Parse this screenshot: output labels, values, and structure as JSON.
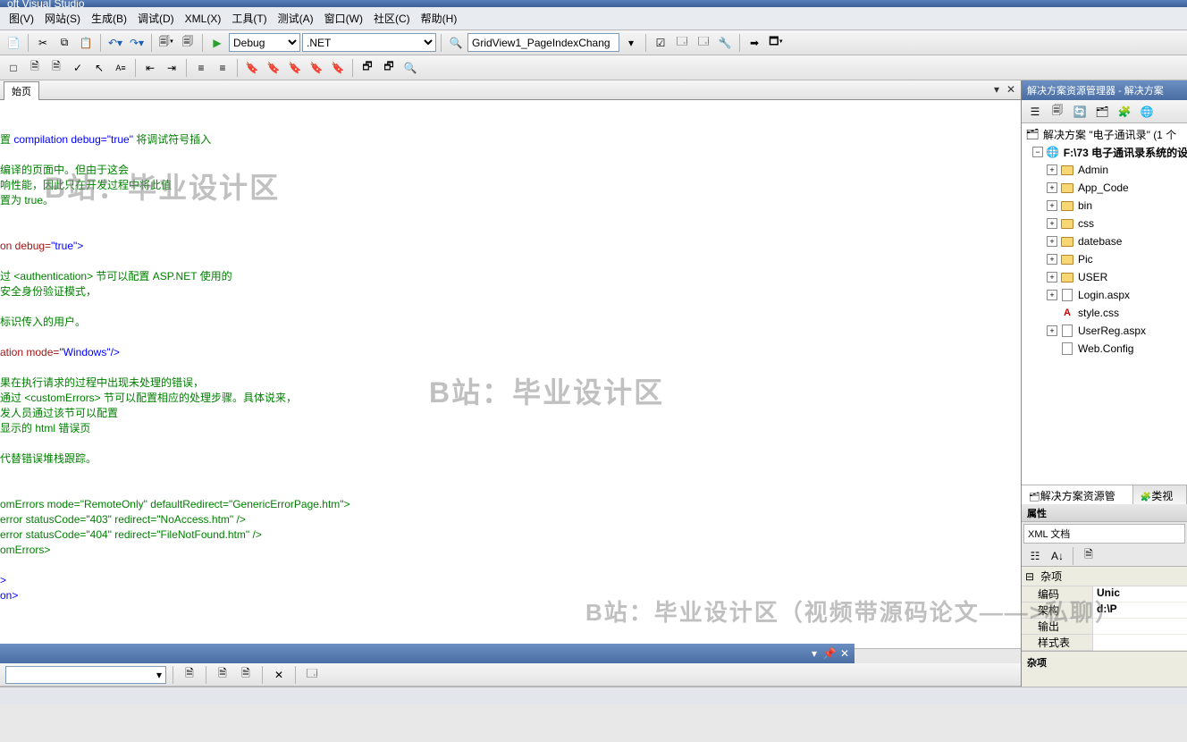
{
  "titlebar": {
    "text": "oft Visual Studio"
  },
  "menu": {
    "view": "图(V)",
    "website": "网站(S)",
    "build": "生成(B)",
    "debug": "调试(D)",
    "xml": "XML(X)",
    "tools": "工具(T)",
    "test": "测试(A)",
    "window": "窗口(W)",
    "community": "社区(C)",
    "help": "帮助(H)"
  },
  "toolbar1": {
    "config": "Debug",
    "platform": ".NET",
    "find": "GridView1_PageIndexChang"
  },
  "doc_tab": {
    "label": "始页"
  },
  "code_lines": [
    {
      "segments": [
        {
          "t": "置 ",
          "c": "green"
        },
        {
          "t": "compilation debug=\"true\"",
          "c": "blue"
        },
        {
          "t": " 将调试符号插入",
          "c": "green"
        }
      ]
    },
    {
      "segments": []
    },
    {
      "segments": [
        {
          "t": "编译的页面中。但由于这会",
          "c": "green"
        }
      ]
    },
    {
      "segments": [
        {
          "t": "响性能，因此只在开发过程中将此值",
          "c": "green"
        }
      ]
    },
    {
      "segments": [
        {
          "t": "置为 true。",
          "c": "green"
        }
      ]
    },
    {
      "segments": []
    },
    {
      "segments": []
    },
    {
      "segments": [
        {
          "t": "on debug=",
          "c": "red"
        },
        {
          "t": "\"true\"",
          "c": "blue"
        },
        {
          "t": ">",
          "c": "blue"
        }
      ]
    },
    {
      "segments": []
    },
    {
      "segments": [
        {
          "t": "过 <authentication> 节可以配置 ASP.NET 使用的",
          "c": "green"
        }
      ]
    },
    {
      "segments": [
        {
          "t": "安全身份验证模式，",
          "c": "green"
        }
      ]
    },
    {
      "segments": []
    },
    {
      "segments": [
        {
          "t": "标识传入的用户。",
          "c": "green"
        }
      ]
    },
    {
      "segments": []
    },
    {
      "segments": [
        {
          "t": "ation mode=",
          "c": "red"
        },
        {
          "t": "\"Windows\"",
          "c": "blue"
        },
        {
          "t": "/>",
          "c": "blue"
        }
      ]
    },
    {
      "segments": []
    },
    {
      "segments": [
        {
          "t": "果在执行请求的过程中出现未处理的错误，",
          "c": "green"
        }
      ]
    },
    {
      "segments": [
        {
          "t": "通过 <customErrors> 节可以配置相应的处理步骤。具体说来，",
          "c": "green"
        }
      ]
    },
    {
      "segments": [
        {
          "t": "发人员通过该节可以配置",
          "c": "green"
        }
      ]
    },
    {
      "segments": [
        {
          "t": "显示的 html 错误页",
          "c": "green"
        }
      ]
    },
    {
      "segments": []
    },
    {
      "segments": [
        {
          "t": "代替错误堆栈跟踪。",
          "c": "green"
        }
      ]
    },
    {
      "segments": []
    },
    {
      "segments": []
    },
    {
      "segments": [
        {
          "t": "omErrors mode=\"RemoteOnly\" defaultRedirect=\"GenericErrorPage.htm\">",
          "c": "green"
        }
      ]
    },
    {
      "segments": [
        {
          "t": "error statusCode=\"403\" redirect=\"NoAccess.htm\" />",
          "c": "green"
        }
      ]
    },
    {
      "segments": [
        {
          "t": "error statusCode=\"404\" redirect=\"FileNotFound.htm\" />",
          "c": "green"
        }
      ]
    },
    {
      "segments": [
        {
          "t": "omErrors>",
          "c": "green"
        }
      ]
    },
    {
      "segments": []
    },
    {
      "segments": [
        {
          "t": ">",
          "c": "blue"
        }
      ]
    },
    {
      "segments": [
        {
          "t": "on>",
          "c": "blue"
        }
      ]
    }
  ],
  "solution_explorer": {
    "title": "解决方案资源管理器 - 解决方案",
    "solution": "解决方案 \"电子通讯录\" (1 个",
    "project": "F:\\73 电子通讯录系统的设",
    "items": [
      {
        "type": "folder",
        "label": "Admin",
        "expandable": true
      },
      {
        "type": "folder",
        "label": "App_Code",
        "expandable": true
      },
      {
        "type": "folder",
        "label": "bin",
        "expandable": true
      },
      {
        "type": "folder",
        "label": "css",
        "expandable": true
      },
      {
        "type": "folder",
        "label": "datebase",
        "expandable": true
      },
      {
        "type": "folder",
        "label": "Pic",
        "expandable": true
      },
      {
        "type": "folder",
        "label": "USER",
        "expandable": true
      },
      {
        "type": "aspx",
        "label": "Login.aspx",
        "expandable": true
      },
      {
        "type": "css",
        "label": "style.css",
        "expandable": false
      },
      {
        "type": "aspx",
        "label": "UserReg.aspx",
        "expandable": true
      },
      {
        "type": "config",
        "label": "Web.Config",
        "expandable": false
      }
    ],
    "tabs": {
      "se": "解决方案资源管理器",
      "cv": "类视图"
    }
  },
  "properties": {
    "title": "属性",
    "selected": "XML 文档",
    "category": "杂项",
    "rows": [
      {
        "name": "编码",
        "value": "Unic"
      },
      {
        "name": "架构",
        "value": "d:\\P"
      },
      {
        "name": "输出",
        "value": ""
      },
      {
        "name": "样式表",
        "value": ""
      }
    ],
    "desc": "杂项"
  },
  "watermarks": {
    "w1": "B站：毕业设计区",
    "w2": "B站：毕业设计区",
    "w3": "B站：毕业设计区（视频带源码论文——>私聊）"
  }
}
